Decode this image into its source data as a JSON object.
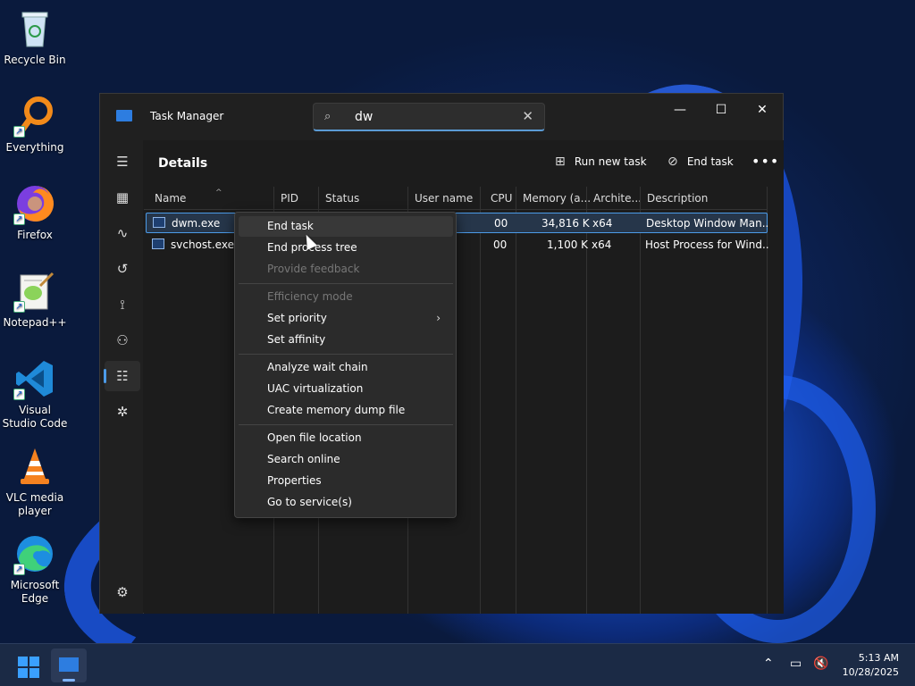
{
  "desktop": {
    "icons": [
      {
        "label": "Recycle Bin"
      },
      {
        "label": "Everything"
      },
      {
        "label": "Firefox"
      },
      {
        "label": "Notepad++"
      },
      {
        "label": "Visual Studio Code"
      },
      {
        "label": "VLC media player"
      },
      {
        "label": "Microsoft Edge"
      }
    ]
  },
  "window": {
    "title": "Task Manager",
    "search": {
      "value": "dw",
      "placeholder": ""
    },
    "page_title": "Details",
    "commands": {
      "run_new_task": "Run new task",
      "end_task": "End task"
    }
  },
  "table": {
    "headers": {
      "name": "Name",
      "pid": "PID",
      "status": "Status",
      "user": "User name",
      "cpu": "CPU",
      "memory": "Memory (a...",
      "arch": "Archite...",
      "desc": "Description"
    },
    "rows": [
      {
        "name": "dwm.exe",
        "cpu": "00",
        "memory": "34,816 K",
        "arch": "x64",
        "desc": "Desktop Window Man..."
      },
      {
        "name": "svchost.exe",
        "cpu": "00",
        "memory": "1,100 K",
        "arch": "x64",
        "desc": "Host Process for Wind..."
      }
    ]
  },
  "context_menu": {
    "items": [
      {
        "label": "End task"
      },
      {
        "label": "End process tree"
      },
      {
        "label": "Provide feedback"
      },
      {
        "label": "Efficiency mode"
      },
      {
        "label": "Set priority"
      },
      {
        "label": "Set affinity"
      },
      {
        "label": "Analyze wait chain"
      },
      {
        "label": "UAC virtualization"
      },
      {
        "label": "Create memory dump file"
      },
      {
        "label": "Open file location"
      },
      {
        "label": "Search online"
      },
      {
        "label": "Properties"
      },
      {
        "label": "Go to service(s)"
      }
    ]
  },
  "taskbar": {
    "time": "5:13 AM",
    "date": "10/28/2025"
  },
  "colors": {
    "accent": "#4c9be8",
    "selection": "#26364a"
  }
}
